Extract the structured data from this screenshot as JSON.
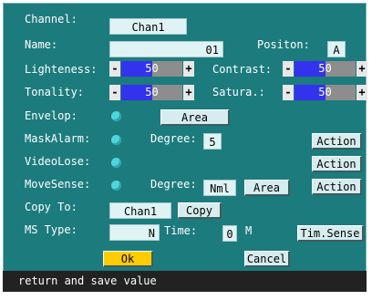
{
  "channel": {
    "label": "Channel:",
    "value": "Chan1"
  },
  "name": {
    "label": "Name:",
    "value": "01"
  },
  "position": {
    "label": "Positon:",
    "value": "A"
  },
  "lighteness": {
    "label": "Lighteness:",
    "value": "50",
    "level": 0.5
  },
  "contrast": {
    "label": "Contrast:",
    "value": "50",
    "level": 0.5
  },
  "tonality": {
    "label": "Tonality:",
    "value": "50",
    "level": 0.5
  },
  "saturation": {
    "label": "Satura.:",
    "value": "50",
    "level": 0.5
  },
  "slider_buttons": {
    "minus": "-",
    "plus": "+"
  },
  "envelop": {
    "label": "Envelop:",
    "area_button": "Area"
  },
  "mask_alarm": {
    "label": "MaskAlarm:",
    "degree_label": "Degree:",
    "degree_value": "5",
    "action_button": "Action"
  },
  "video_lose": {
    "label": "VideoLose:",
    "action_button": "Action"
  },
  "move_sense": {
    "label": "MoveSense:",
    "degree_label": "Degree:",
    "degree_value": "Nml",
    "area_button": "Area",
    "action_button": "Action"
  },
  "copy_to": {
    "label": "Copy To:",
    "value": "Chan1",
    "copy_button": "Copy"
  },
  "ms_type": {
    "label": "MS Type:",
    "value": "N",
    "time_label": "Time:",
    "time_value": "0",
    "time_unit": "M",
    "tim_sense_button": "Tim.Sense"
  },
  "buttons": {
    "ok": "Ok",
    "cancel": "Cancel"
  },
  "status": {
    "text": "return and save value"
  },
  "colors": {
    "panel": "#1c7b7d",
    "field": "#dff3f5",
    "slider_fill": "#3333ee",
    "ok_button": "#ffcc00",
    "status_bar": "#222222",
    "toggle_dot": "#4fd6dc"
  }
}
